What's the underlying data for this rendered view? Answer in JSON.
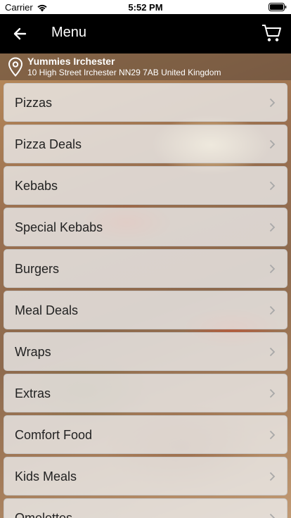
{
  "status_bar": {
    "carrier": "Carrier",
    "time": "5:52 PM",
    "wifi_icon": "wifi-icon",
    "battery_icon": "battery-icon"
  },
  "nav": {
    "title": "Menu",
    "back_icon": "arrow-left-icon",
    "cart_icon": "cart-icon",
    "background": "#000000",
    "text_color": "#ffffff"
  },
  "restaurant": {
    "name": "Yummies Irchester",
    "address": "10 High Street Irchester NN29 7AB United Kingdom",
    "icon": "map-pin-icon"
  },
  "menu": {
    "items": [
      {
        "label": "Pizzas"
      },
      {
        "label": "Pizza Deals"
      },
      {
        "label": "Kebabs"
      },
      {
        "label": "Special Kebabs"
      },
      {
        "label": "Burgers"
      },
      {
        "label": "Meal Deals"
      },
      {
        "label": "Wraps"
      },
      {
        "label": "Extras"
      },
      {
        "label": "Comfort Food"
      },
      {
        "label": "Kids Meals"
      },
      {
        "label": "Omelettes"
      }
    ],
    "chevron_icon": "chevron-right-icon"
  }
}
